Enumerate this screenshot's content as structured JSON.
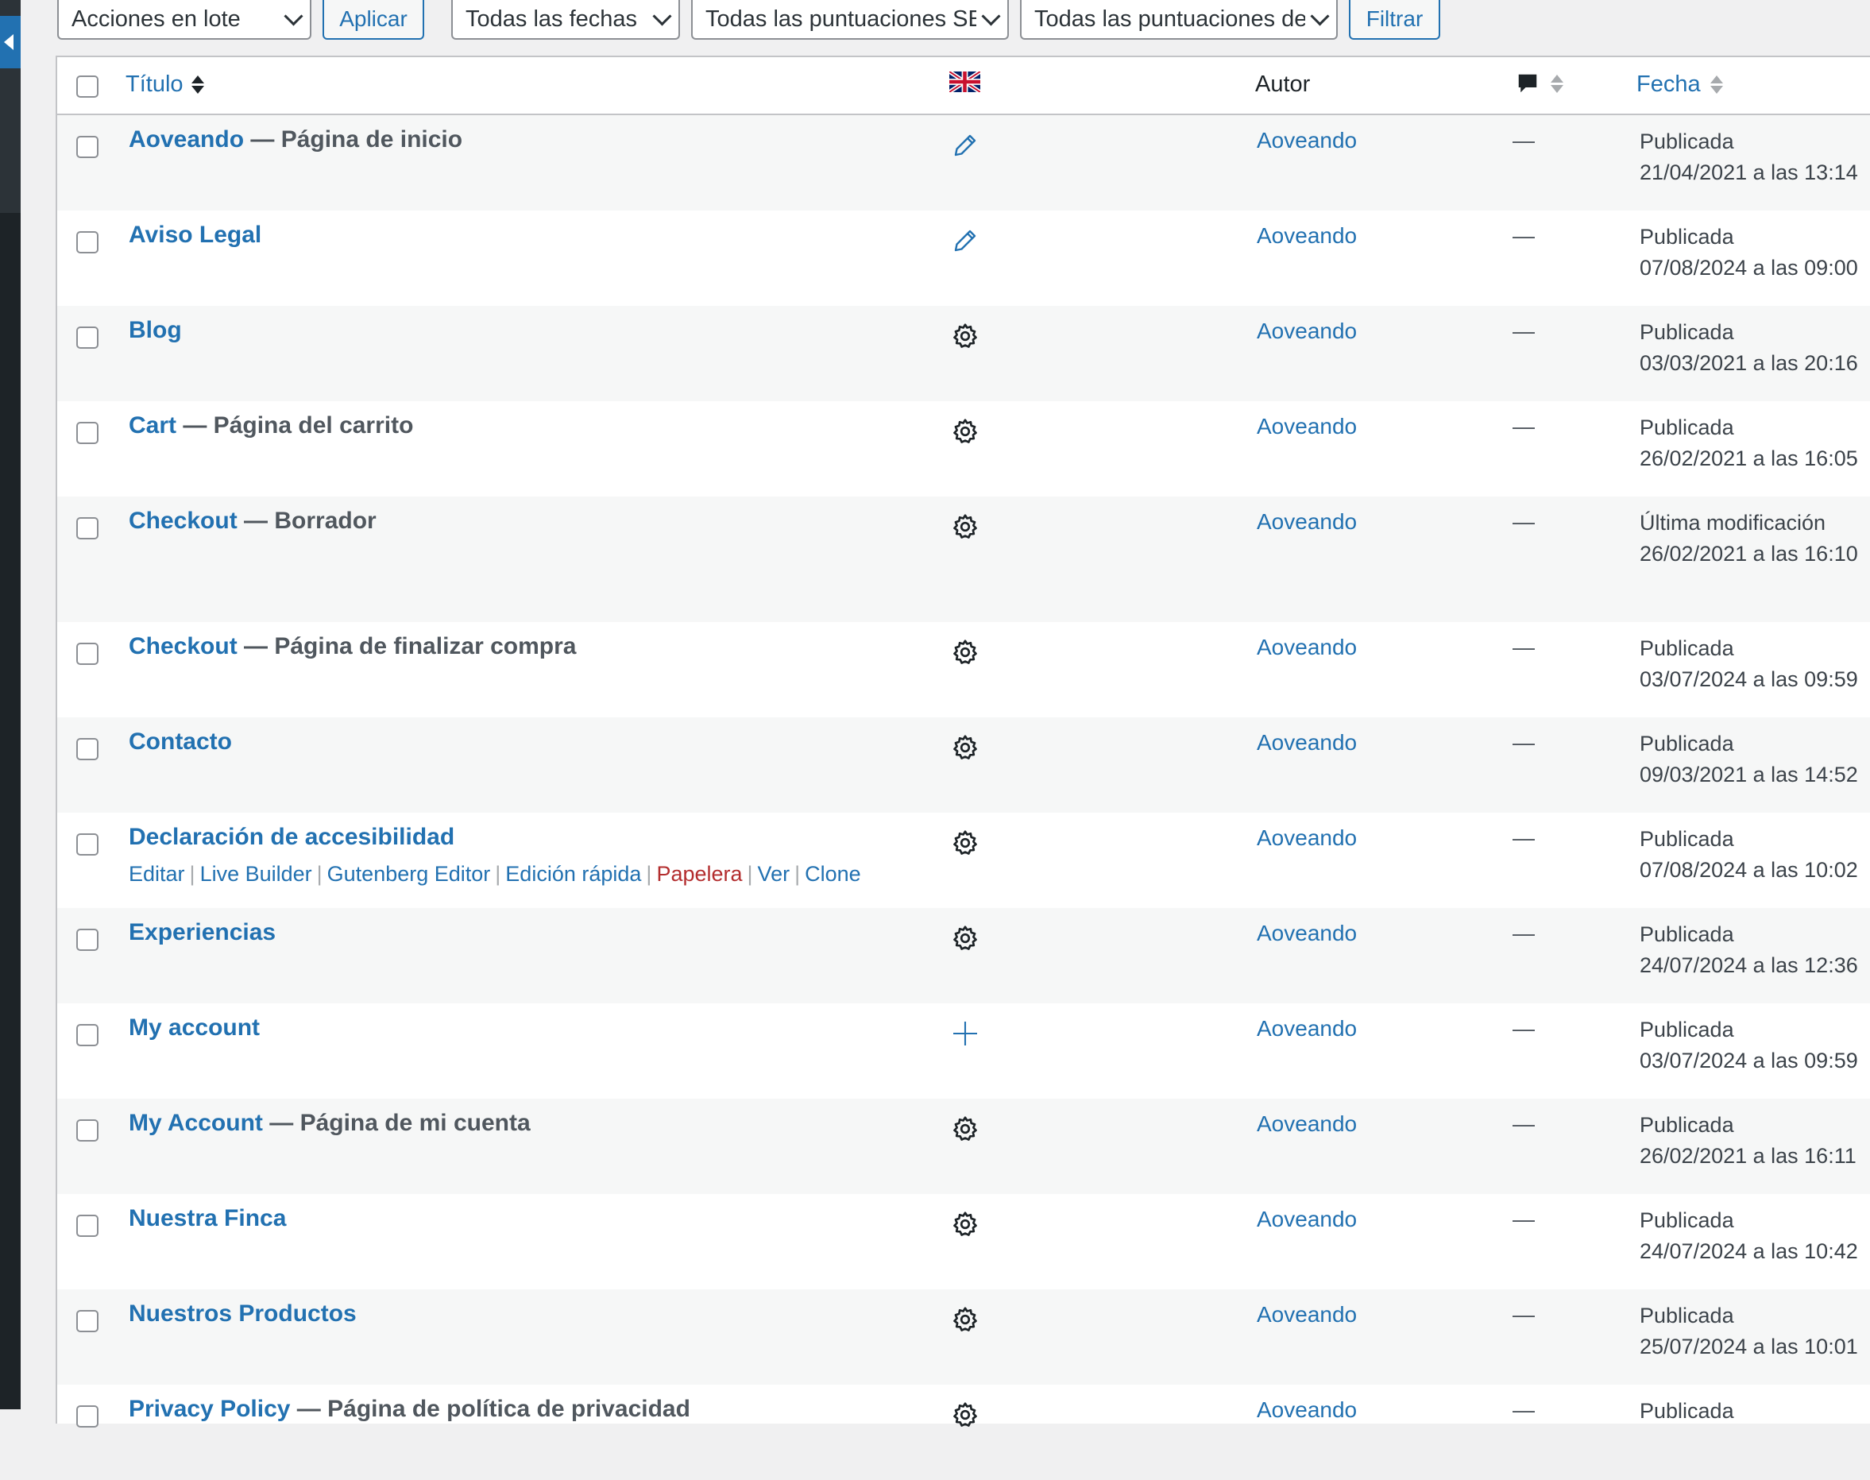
{
  "toolbar": {
    "bulk_actions": "Acciones en lote",
    "apply": "Aplicar",
    "dates": "Todas las fechas",
    "scores_seo": "Todas las puntuaciones SEO",
    "scores_read": "Todas las puntuaciones de legibilidad",
    "filter": "Filtrar"
  },
  "header": {
    "title": "Título",
    "author": "Autor",
    "date": "Fecha"
  },
  "rows": [
    {
      "title": "Aoveando",
      "state": " — Página de inicio",
      "lang": "pencil-icon",
      "author": "Aoveando",
      "comments": "—",
      "status": "Publicada",
      "date": "21/04/2021 a las 13:14"
    },
    {
      "title": "Aviso Legal",
      "state": "",
      "lang": "pencil-icon",
      "author": "Aoveando",
      "comments": "—",
      "status": "Publicada",
      "date": "07/08/2024 a las 09:00"
    },
    {
      "title": "Blog",
      "state": "",
      "lang": "gear-icon",
      "author": "Aoveando",
      "comments": "—",
      "status": "Publicada",
      "date": "03/03/2021 a las 20:16"
    },
    {
      "title": "Cart",
      "state": " — Página del carrito",
      "lang": "gear-icon",
      "author": "Aoveando",
      "comments": "—",
      "status": "Publicada",
      "date": "26/02/2021 a las 16:05"
    },
    {
      "title": "Checkout",
      "state": " — Borrador",
      "lang": "gear-icon",
      "author": "Aoveando",
      "comments": "—",
      "status": "Última modificación",
      "date": "26/02/2021 a las 16:10"
    },
    {
      "title": "Checkout",
      "state": " — Página de finalizar compra",
      "lang": "gear-icon",
      "author": "Aoveando",
      "comments": "—",
      "status": "Publicada",
      "date": "03/07/2024 a las 09:59"
    },
    {
      "title": "Contacto",
      "state": "",
      "lang": "gear-icon",
      "author": "Aoveando",
      "comments": "—",
      "status": "Publicada",
      "date": "09/03/2021 a las 14:52"
    },
    {
      "title": "Declaración de accesibilidad",
      "state": "",
      "lang": "gear-icon",
      "author": "Aoveando",
      "comments": "—",
      "status": "Publicada",
      "date": "07/08/2024 a las 10:02"
    },
    {
      "title": "Experiencias",
      "state": "",
      "lang": "gear-icon",
      "author": "Aoveando",
      "comments": "—",
      "status": "Publicada",
      "date": "24/07/2024 a las 12:36"
    },
    {
      "title": "My account",
      "state": "",
      "lang": "plus-icon",
      "author": "Aoveando",
      "comments": "—",
      "status": "Publicada",
      "date": "03/07/2024 a las 09:59"
    },
    {
      "title": "My Account",
      "state": " — Página de mi cuenta",
      "lang": "gear-icon",
      "author": "Aoveando",
      "comments": "—",
      "status": "Publicada",
      "date": "26/02/2021 a las 16:11"
    },
    {
      "title": "Nuestra Finca",
      "state": "",
      "lang": "gear-icon",
      "author": "Aoveando",
      "comments": "—",
      "status": "Publicada",
      "date": "24/07/2024 a las 10:42"
    },
    {
      "title": "Nuestros Productos",
      "state": "",
      "lang": "gear-icon",
      "author": "Aoveando",
      "comments": "—",
      "status": "Publicada",
      "date": "25/07/2024 a las 10:01"
    },
    {
      "title": "Privacy Policy",
      "state": " — Página de política de privacidad",
      "lang": "gear-icon",
      "author": "Aoveando",
      "comments": "—",
      "status": "Publicada",
      "date": ""
    }
  ],
  "row_actions": {
    "edit": "Editar",
    "live_builder": "Live Builder",
    "gutenberg": "Gutenberg Editor",
    "quick_edit": "Edición rápida",
    "trash": "Papelera",
    "view": "Ver",
    "clone": "Clone"
  },
  "colors": {
    "link": "#2271b1",
    "trash": "#b32d2e",
    "admin_menu": "#1d2327"
  }
}
